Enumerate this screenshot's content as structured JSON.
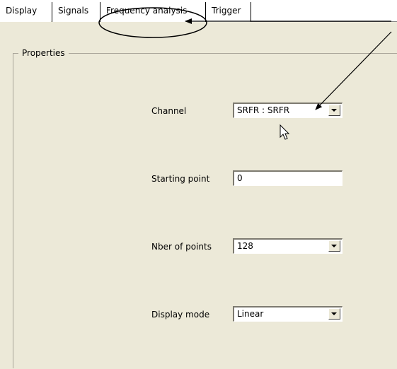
{
  "tabs": [
    {
      "label": "Display"
    },
    {
      "label": "Signals"
    },
    {
      "label": "Frequency analysis"
    },
    {
      "label": "Trigger"
    }
  ],
  "group": {
    "title": "Properties"
  },
  "fields": {
    "channel": {
      "label": "Channel",
      "value": "SRFR : SRFR"
    },
    "starting_point": {
      "label": "Starting point",
      "value": "0"
    },
    "nber_of_points": {
      "label": "Nber of points",
      "value": "128"
    },
    "display_mode": {
      "label": "Display mode",
      "value": "Linear"
    }
  }
}
